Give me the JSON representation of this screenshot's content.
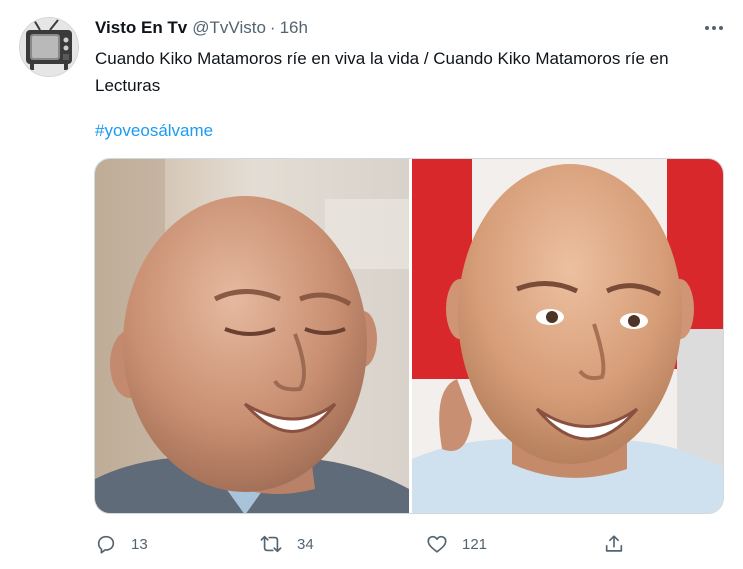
{
  "tweet": {
    "author_name": "Visto En Tv",
    "handle": "@TvVisto",
    "separator": "·",
    "time": "16h",
    "text": "Cuando Kiko Matamoros ríe en viva la vida / Cuando Kiko Matamoros ríe en Lecturas",
    "hashtag": "#yoveosálvame",
    "images": [
      "photo-laughing-man-left",
      "photo-smiling-man-right"
    ]
  },
  "actions": {
    "replies": "13",
    "retweets": "34",
    "likes": "121"
  },
  "icons": {
    "more": "more-horizontal-icon",
    "reply": "reply-icon",
    "retweet": "retweet-icon",
    "like": "heart-icon",
    "share": "share-icon"
  },
  "colors": {
    "text": "#0f1419",
    "secondary": "#536471",
    "link": "#1d9bf0",
    "border": "#cfd9de"
  }
}
